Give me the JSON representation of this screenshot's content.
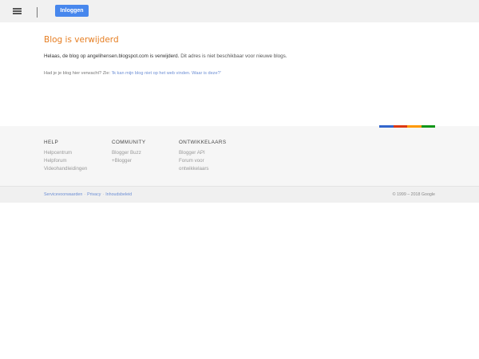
{
  "header": {
    "login_label": "Inloggen"
  },
  "main": {
    "title": "Blog is verwijderd",
    "message_prefix": "Helaas, de blog op ",
    "blog_url": "angelihensen.blogspot.com",
    "message_mid": "  is verwijderd. ",
    "message_suffix": "Dit adres is niet beschikbaar voor nieuwe blogs.",
    "help_prefix": "Had je je blog hier verwacht? Zie: ",
    "help_link": "'Ik kan mijn blog niet op het web vinden. Waar is deze?'"
  },
  "footer": {
    "columns": [
      {
        "heading": "HELP",
        "links": [
          "Helpcentrum",
          "Helpforum",
          "Videohandleidingen"
        ]
      },
      {
        "heading": "COMMUNITY",
        "links": [
          "Blogger Buzz",
          "+Blogger"
        ]
      },
      {
        "heading": "ONTWIKKELAARS",
        "links": [
          "Blogger API",
          "Forum voor ontwikkelaars"
        ]
      }
    ],
    "bottom_links": [
      "Servicevoorwaarden",
      "Privacy",
      "Inhoudsbeleid"
    ],
    "separator": "·",
    "copyright": "© 1999 – 2018 Google"
  },
  "colors": {
    "accent_title": "#e67e22",
    "button_blue": "#4787ed",
    "link_blue": "#6c8ed4",
    "bar_colors": [
      "#3366cc",
      "#dc3912",
      "#ff9900",
      "#109618"
    ]
  }
}
